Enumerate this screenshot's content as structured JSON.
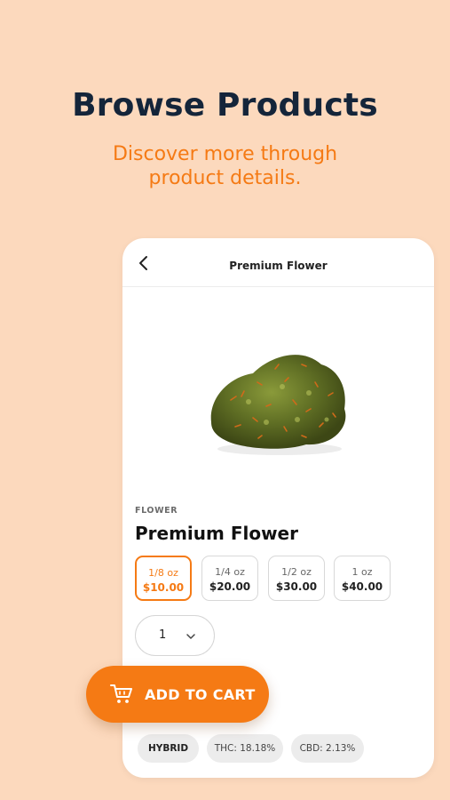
{
  "hero": {
    "title": "Browse Products",
    "subtitle_line1": "Discover more through",
    "subtitle_line2": "product details."
  },
  "screen": {
    "topbar_title": "Premium Flower",
    "category": "FLOWER",
    "product_name": "Premium Flower",
    "weights": [
      {
        "weight": "1/8 oz",
        "price": "$10.00",
        "selected": true
      },
      {
        "weight": "1/4 oz",
        "price": "$20.00",
        "selected": false
      },
      {
        "weight": "1/2 oz",
        "price": "$30.00",
        "selected": false
      },
      {
        "weight": "1 oz",
        "price": "$40.00",
        "selected": false
      }
    ],
    "quantity": "1",
    "chips": {
      "strain": "HYBRID",
      "thc": "THC: 18.18%",
      "cbd": "CBD: 2.13%"
    }
  },
  "cart_button": {
    "label": "ADD TO CART",
    "icon": "cart-icon"
  },
  "colors": {
    "background": "#fcd9bd",
    "accent": "#f57a14",
    "headline": "#14253a"
  }
}
